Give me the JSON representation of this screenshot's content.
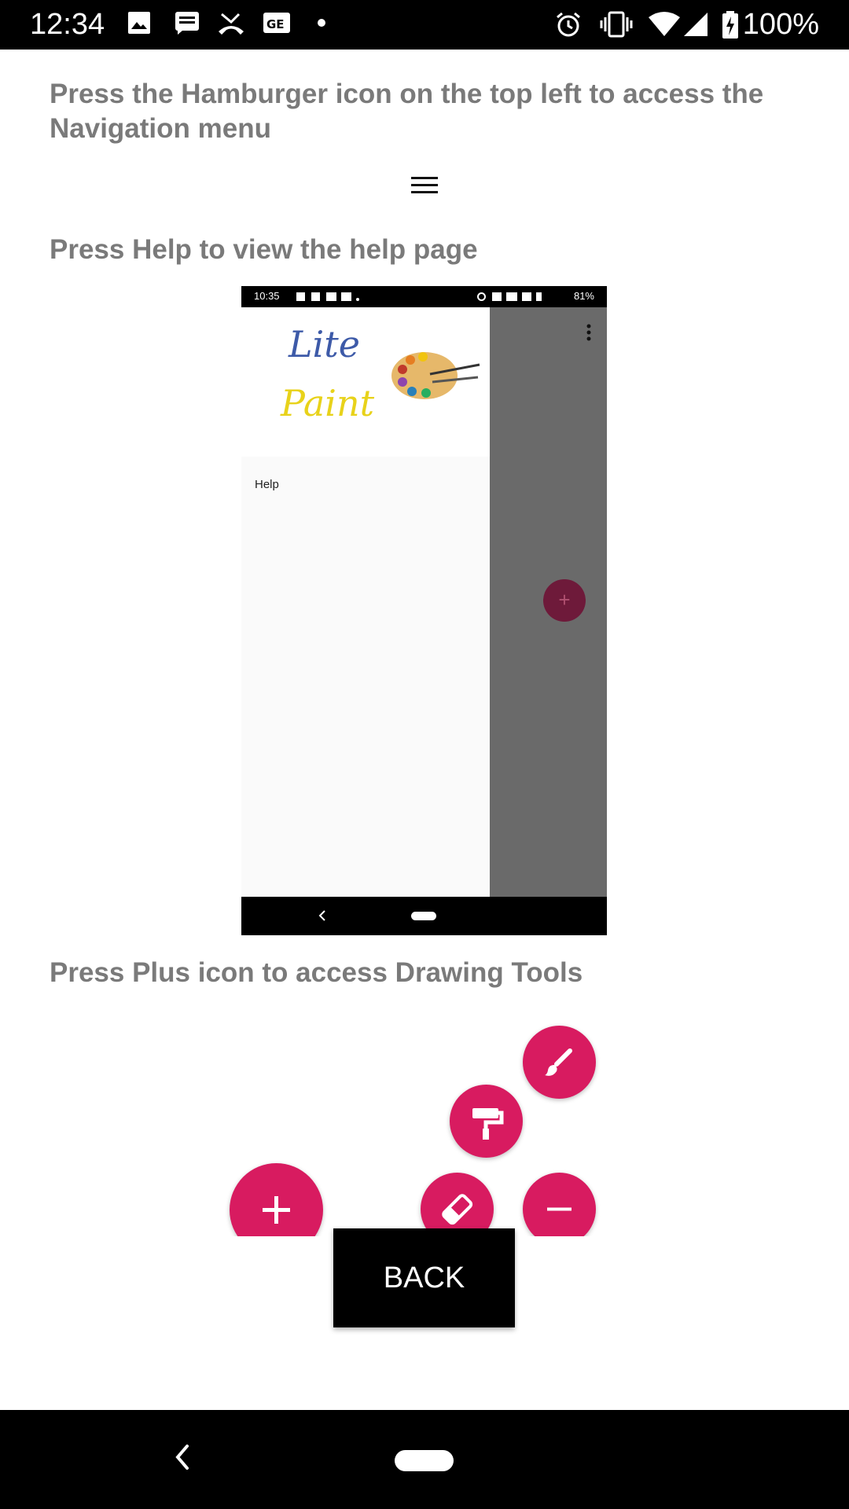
{
  "status_bar": {
    "time": "12:34",
    "battery": "100%",
    "icons": [
      "image-icon",
      "message-icon",
      "missed-call-icon",
      "card-icon",
      "dot-icon",
      "alarm-icon",
      "vibrate-icon",
      "wifi-icon",
      "signal-icon",
      "battery-icon"
    ]
  },
  "content": {
    "instruction_1": "Press the Hamburger icon on the top left to access the Navigation menu",
    "instruction_2": "Press Help to view the help page",
    "instruction_3": "Press Plus icon to access Drawing Tools",
    "help_screenshot": {
      "time": "10:35",
      "battery": "81%",
      "logo_line_1": "Lite",
      "logo_line_2": "Paint",
      "menu_item": "Help"
    }
  },
  "back_button": {
    "label": "BACK"
  },
  "colors": {
    "accent": "#d81b60",
    "text_gray": "#7a7a7a"
  }
}
